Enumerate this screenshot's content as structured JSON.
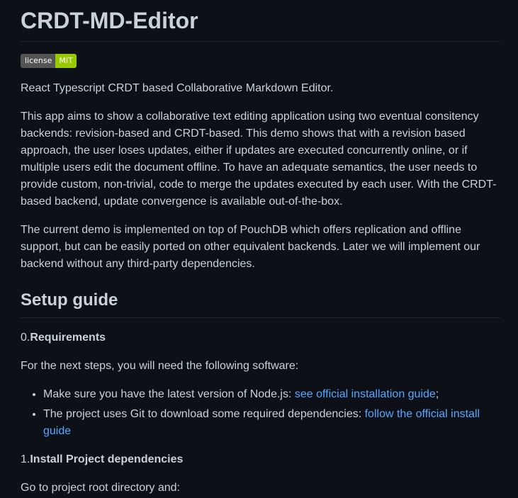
{
  "title": "CRDT-MD-Editor",
  "badge": {
    "left": "license",
    "right": "MIT"
  },
  "intro": "React Typescript CRDT based Collaborative Markdown Editor.",
  "description": "This app aims to show a collaborative text editing application using two eventual consitency backends: revision-based and CRDT-based. This demo shows that with a revision based approach, the user loses updates, either if updates are executed concurrently online, or if multiple users edit the document offline. To have an adequate semantics, the user needs to provide custom, non-trivial, code to merge the updates executed by each user. With the CRDT-based backend, update convergence is available out-of-the-box.",
  "current_demo": "The current demo is implemented on top of PouchDB which offers replication and offline support, but can be easily ported on other equivalent backends. Later we will implement our backend without any third-party dependencies.",
  "setup": {
    "heading": "Setup guide",
    "step0": {
      "number": "0.",
      "title": "Requirements",
      "text": "For the next steps, you will need the following software:",
      "items": [
        {
          "text": "Make sure you have the latest version of Node.js: ",
          "link": "see official installation guide",
          "suffix": ";"
        },
        {
          "text": "The project uses Git to download some required dependencies: ",
          "link": "follow the official install guide",
          "suffix": ""
        }
      ]
    },
    "step1": {
      "number": "1.",
      "title": "Install Project dependencies",
      "text": "Go to project root directory and:"
    }
  },
  "colors": {
    "background": "#0d1117",
    "text": "#c9d1d9",
    "link": "#58a6ff",
    "badge_left": "#555555",
    "badge_right": "#97ca00",
    "divider": "#21262d"
  }
}
